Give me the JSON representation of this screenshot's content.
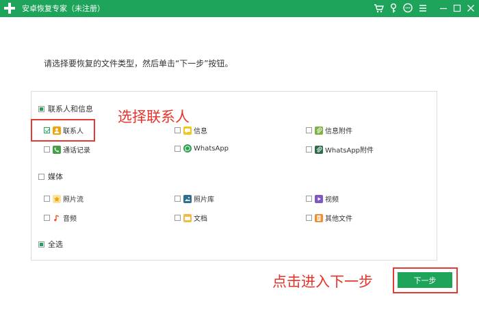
{
  "window": {
    "title": "安卓恢复专家（未注册）",
    "brand_color": "#1ea35a",
    "buttons": [
      {
        "name": "cart-icon"
      },
      {
        "name": "key-icon"
      },
      {
        "name": "chat-icon"
      },
      {
        "name": "menu-icon"
      },
      {
        "name": "minimize-icon"
      },
      {
        "name": "maximize-icon"
      },
      {
        "name": "close-icon"
      }
    ]
  },
  "instruction": "请选择要恢复的文件类型，然后单击“下一步”按钮。",
  "sections": {
    "contacts_messages": {
      "label": "联系人和信息",
      "state": "partial",
      "items": [
        {
          "label": "联系人",
          "icon": "contact-icon",
          "checked": true
        },
        {
          "label": "信息",
          "icon": "message-icon",
          "checked": false
        },
        {
          "label": "信息附件",
          "icon": "attachment-icon",
          "checked": false
        },
        {
          "label": "通话记录",
          "icon": "phone-icon",
          "checked": false
        },
        {
          "label": "WhatsApp",
          "icon": "whatsapp-icon",
          "checked": false
        },
        {
          "label": "WhatsApp附件",
          "icon": "whatsapp-attachment-icon",
          "checked": false
        }
      ]
    },
    "media": {
      "label": "媒体",
      "state": "unchecked",
      "items": [
        {
          "label": "照片流",
          "icon": "photo-stream-icon",
          "checked": false
        },
        {
          "label": "照片库",
          "icon": "photo-library-icon",
          "checked": false
        },
        {
          "label": "视频",
          "icon": "video-icon",
          "checked": false
        },
        {
          "label": "音频",
          "icon": "audio-icon",
          "checked": false
        },
        {
          "label": "文档",
          "icon": "document-icon",
          "checked": false
        },
        {
          "label": "其他文件",
          "icon": "other-files-icon",
          "checked": false
        }
      ]
    },
    "select_all": {
      "label": "全选",
      "state": "partial"
    }
  },
  "annotations": {
    "select_contacts": "选择联系人",
    "click_next": "点击进入下一步",
    "color": "#e53935"
  },
  "next_button": {
    "label": "下一步"
  }
}
